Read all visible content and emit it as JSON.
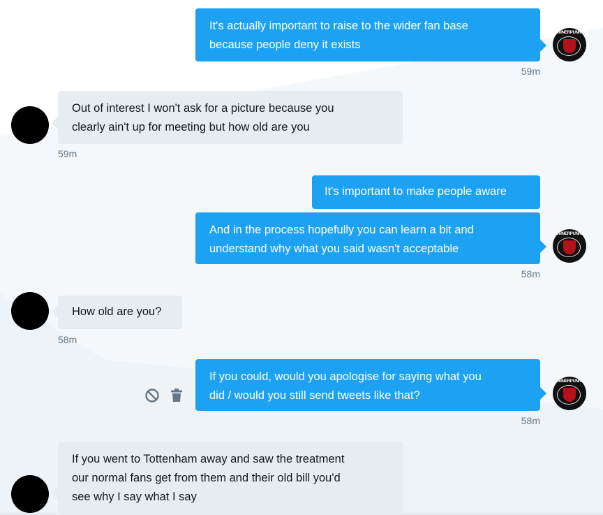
{
  "conversation": {
    "self_avatar_label": "GUNNERPUNNER",
    "messages": [
      {
        "id": "m1",
        "direction": "out",
        "lines": [
          "It's actually important to raise to the wider fan base",
          "because people deny it exists"
        ],
        "time": "59m"
      },
      {
        "id": "m2",
        "direction": "in",
        "lines": [
          "Out of interest I won't ask for a picture because you",
          "clearly ain't up for meeting but how old are you"
        ],
        "time": "59m"
      },
      {
        "id": "m3",
        "direction": "out",
        "lines": [
          "It's important to make people aware"
        ],
        "time": ""
      },
      {
        "id": "m4",
        "direction": "out",
        "lines": [
          "And in the process hopefully you can learn a bit and",
          "understand why what you said wasn't acceptable"
        ],
        "time": "58m"
      },
      {
        "id": "m5",
        "direction": "in",
        "lines": [
          "How old are you?"
        ],
        "time": "58m"
      },
      {
        "id": "m6",
        "direction": "out",
        "lines": [
          "If you could, would you apologise for saying what you",
          "did / would you still send tweets like that?"
        ],
        "time": "58m"
      },
      {
        "id": "m7",
        "direction": "in",
        "lines": [
          "If you went to Tottenham away and saw the treatment",
          "our normal fans get from them and their old bill you'd",
          "see why I say what I say"
        ],
        "time": ""
      }
    ],
    "message_actions": [
      {
        "name": "block-icon"
      },
      {
        "name": "trash-icon"
      }
    ]
  },
  "colors": {
    "outgoing_bubble": "#1da1f2",
    "incoming_bubble": "#e6ecf0",
    "timestamp": "#657786",
    "background_shape": "#f5f8fa"
  }
}
